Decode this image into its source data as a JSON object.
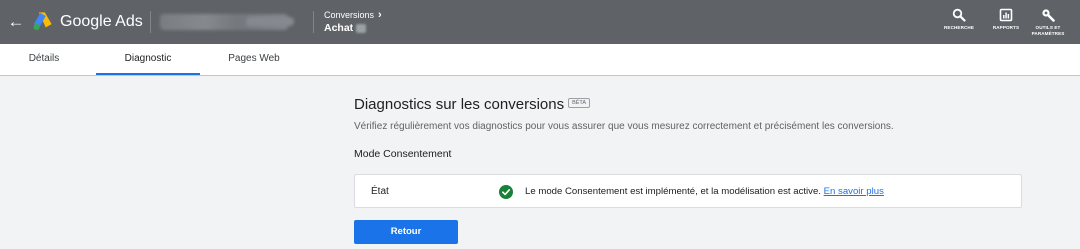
{
  "header": {
    "brand": "Google Ads",
    "breadcrumb_parent": "Conversions",
    "breadcrumb_current": "Achat",
    "tools": [
      {
        "icon": "search-icon",
        "label": "RECHERCHE"
      },
      {
        "icon": "reports-icon",
        "label": "RAPPORTS"
      },
      {
        "icon": "wrench-icon",
        "label": "OUTILS ET PARAMÈTRES"
      }
    ],
    "bar_color": "#5f6368"
  },
  "tabs": [
    {
      "label": "Détails"
    },
    {
      "label": "Diagnostic",
      "active": true
    },
    {
      "label": "Pages Web"
    }
  ],
  "main": {
    "title": "Diagnostics sur les conversions",
    "beta": "BÊTA",
    "subtitle": "Vérifiez régulièrement vos diagnostics pour vous assurer que vous mesurez correctement et précisément les conversions.",
    "section_title": "Mode Consentement",
    "status_label": "État",
    "status_text": "Le mode Consentement est implémenté, et la modélisation est active.",
    "status_link": "En savoir plus",
    "status_color": "#188038",
    "back_button": "Retour",
    "accent": "#1a73e8"
  }
}
